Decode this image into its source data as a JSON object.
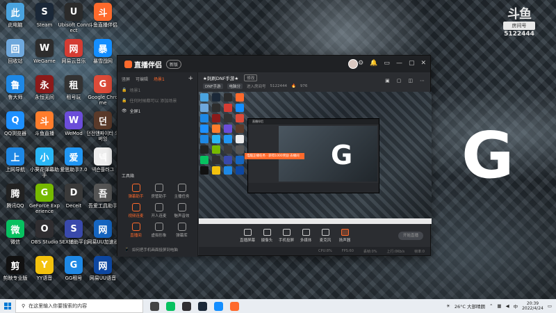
{
  "desktop": {
    "icons": [
      {
        "label": "此电脑",
        "icon": "computer-icon",
        "color": "#4aa3df"
      },
      {
        "label": "Steam",
        "icon": "steam-icon",
        "color": "#1b2838"
      },
      {
        "label": "Ubisoft Connect",
        "icon": "ubisoft-icon",
        "color": "#2b2b2b"
      },
      {
        "label": "斗鱼直播伴侣",
        "icon": "douyu-icon",
        "color": "#ff6a2c"
      },
      {
        "label": "回收站",
        "icon": "recycle-bin-icon",
        "color": "#6fa8dc"
      },
      {
        "label": "WeGame",
        "icon": "wegame-icon",
        "color": "#2d2d2d"
      },
      {
        "label": "网易云音乐",
        "icon": "netease-music-icon",
        "color": "#d43c33"
      },
      {
        "label": "暴雪战网",
        "icon": "battlenet-icon",
        "color": "#148eff"
      },
      {
        "label": "鲁大师",
        "icon": "ludashi-icon",
        "color": "#1e88e5"
      },
      {
        "label": "永恒无间",
        "icon": "naraka-icon",
        "color": "#8b1a1a"
      },
      {
        "label": "租号玩",
        "icon": "zuhaowan-icon",
        "color": "#333333"
      },
      {
        "label": "Google Chrome",
        "icon": "chrome-icon",
        "color": "#dd4b39"
      },
      {
        "label": "QQ浏览器",
        "icon": "qq-browser-icon",
        "color": "#1e90ff"
      },
      {
        "label": "斗鱼直播",
        "icon": "douyu-live-icon",
        "color": "#ff7d2c"
      },
      {
        "label": "WeMod",
        "icon": "wemod-icon",
        "color": "#6b4dd9"
      },
      {
        "label": "던전앤파이터 오버잉",
        "icon": "dnf-icon",
        "color": "#5a3a2a"
      },
      {
        "label": "上网导航",
        "icon": "ie-icon",
        "color": "#1e88e5"
      },
      {
        "label": "小葵花弹幕助手",
        "icon": "danmu-icon",
        "color": "#29b6f6"
      },
      {
        "label": "爱思助手7.0",
        "icon": "i4-icon",
        "color": "#2196f3"
      },
      {
        "label": "넥슨플러그",
        "icon": "nexon-icon",
        "color": "#eeeeee"
      },
      {
        "label": "腾讯QQ",
        "icon": "qq-icon",
        "color": "#222222"
      },
      {
        "label": "GeForce Experience",
        "icon": "geforce-icon",
        "color": "#76b900"
      },
      {
        "label": "Deceit",
        "icon": "deceit-icon",
        "color": "#3a3a3a"
      },
      {
        "label": "吾爱工具助手",
        "icon": "tool-icon",
        "color": "#555555"
      },
      {
        "label": "微信",
        "icon": "wechat-icon",
        "color": "#07c160"
      },
      {
        "label": "OBS Studio",
        "icon": "obs-icon",
        "color": "#302e31"
      },
      {
        "label": "SEX辅助平台",
        "icon": "assist-icon",
        "color": "#3949ab"
      },
      {
        "label": "网易UU加速器",
        "icon": "uu-icon",
        "color": "#1565c0"
      },
      {
        "label": "剪映专业版",
        "icon": "capcut-icon",
        "color": "#111111"
      },
      {
        "label": "YY语音",
        "icon": "yy-icon",
        "color": "#f4c20d"
      },
      {
        "label": "GG租号",
        "icon": "gg-icon",
        "color": "#1e88e5"
      },
      {
        "label": "网易UU语音",
        "icon": "uu-voice-icon",
        "color": "#0d47a1"
      }
    ],
    "watermark": {
      "logo": "斗鱼",
      "room_label": "房间号",
      "room_number": "5122444"
    },
    "big_logo": "G"
  },
  "app": {
    "name": "直播伴侣",
    "badge": "新版",
    "window_controls": [
      "⚙",
      "🔔",
      "▭",
      "—",
      "▢",
      "✕"
    ],
    "sidebar": {
      "tabs": [
        "竖屏",
        "可编辑",
        "场景1"
      ],
      "scenes": [
        "场景1",
        "任何时候都可以 添加场景",
        "全屏1"
      ],
      "tools_title": "工具箱",
      "tools": [
        "弹幕助手",
        "房管助手",
        "主播任务",
        "视频连麦",
        "开人连麦",
        "魅声音效",
        "直播间",
        "虚拟形象",
        "弹幕库"
      ],
      "footer": "如何把手机画面投屏到电脑"
    },
    "room": {
      "title": "★刺刷DNF手游★",
      "edit": "修改",
      "tag1": "DNF手游",
      "tag2": "电脑分",
      "room_label": "进入房间号",
      "room_id": "5122444",
      "fans": "976"
    },
    "preview": {
      "nested_title": "直播伴侣",
      "toast": "电脑正播任务 · 获得1000奖励 去播间"
    },
    "controls": [
      "直播屏幕",
      "摄像头",
      "手机投屏",
      "多媒体",
      "麦克风",
      "扬声器"
    ],
    "start_label": "开始直播",
    "status": [
      "CPU:8%",
      "FPS:60",
      "丢帧:0%",
      "上行:0Kb/s",
      "帧率:0"
    ]
  },
  "taskbar": {
    "search_placeholder": "在这里输入你要搜索的内容",
    "pinned": [
      {
        "icon": "task-view-icon",
        "color": "#444444"
      },
      {
        "icon": "wechat-task-icon",
        "color": "#07c160"
      },
      {
        "icon": "obs-task-icon",
        "color": "#302e31"
      },
      {
        "icon": "steam-task-icon",
        "color": "#1b2838"
      },
      {
        "icon": "battlenet-task-icon",
        "color": "#148eff"
      },
      {
        "icon": "douyu-task-icon",
        "color": "#ff6a2c"
      }
    ],
    "weather": "26°C 大部晴朗",
    "time": "20:39",
    "date": "2022/4/24"
  },
  "colors": {
    "accent": "#ff6a2c",
    "taskbar": "#e9edf2",
    "app_bg": "#2b2d31"
  }
}
